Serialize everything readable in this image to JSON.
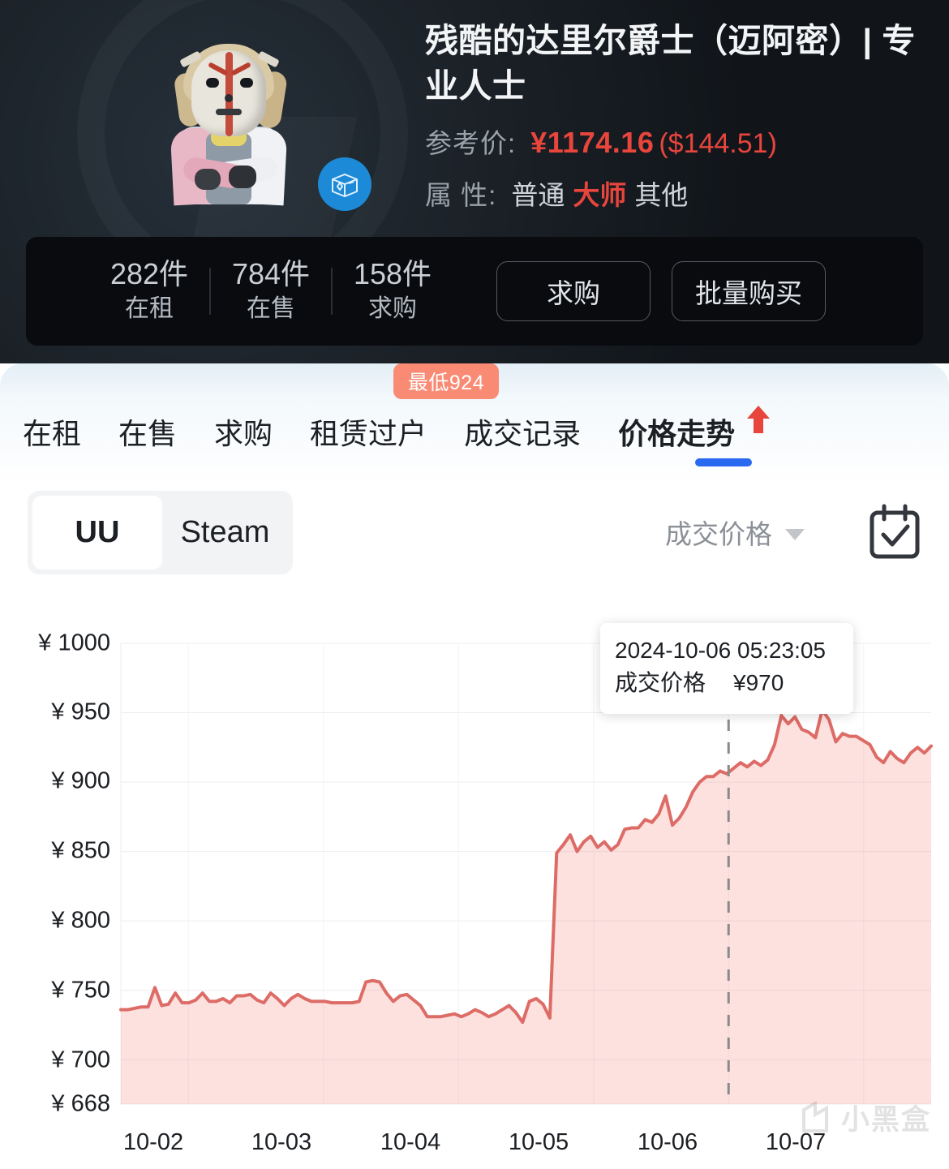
{
  "hero": {
    "title": "残酷的达里尔爵士（迈阿密）| 专业人士",
    "ref_price_label": "参考价:",
    "price_cny": "¥1174.16",
    "price_usd": "($144.51)",
    "attr_label": "属 性:",
    "attr_normal": "普通",
    "attr_highlight": "大师",
    "attr_other": "其他",
    "case_icon": "case-box-icon"
  },
  "stats": {
    "items": [
      {
        "count": "282件",
        "caption": "在租"
      },
      {
        "count": "784件",
        "caption": "在售"
      },
      {
        "count": "158件",
        "caption": "求购"
      }
    ],
    "buy_request_label": "求购",
    "bulk_buy_label": "批量购买"
  },
  "low_badge": "最低924",
  "tabs": [
    {
      "label": "在租",
      "active": false
    },
    {
      "label": "在售",
      "active": false
    },
    {
      "label": "求购",
      "active": false
    },
    {
      "label": "租赁过户",
      "active": false
    },
    {
      "label": "成交记录",
      "active": false
    },
    {
      "label": "价格走势",
      "active": true
    }
  ],
  "source_toggle": {
    "uu": "UU",
    "steam": "Steam",
    "selected": "UU"
  },
  "price_select": {
    "value": "成交价格"
  },
  "calendar_icon": "calendar-check-icon",
  "tooltip": {
    "date": "2024-10-06 05:23:05",
    "metric": "成交价格",
    "value": "¥970"
  },
  "watermark": "小黑盒",
  "colors": {
    "accent_red": "#e8453c",
    "line": "#dd6b66",
    "tab_indicator": "#2a6af0",
    "badge": "#f98b75"
  },
  "chart_data": {
    "type": "area",
    "title": "价格走势",
    "xlabel": "",
    "ylabel": "¥",
    "ylim": [
      668,
      1000
    ],
    "grid": true,
    "legend": false,
    "ytick_labels": [
      "¥ 1000",
      "¥ 950",
      "¥ 900",
      "¥ 850",
      "¥ 800",
      "¥ 750",
      "¥ 700",
      "¥ 668"
    ],
    "yticks": [
      1000,
      950,
      900,
      850,
      800,
      750,
      700,
      668
    ],
    "xtick_labels": [
      "10-02",
      "10-03",
      "10-04",
      "10-05",
      "10-06",
      "10-07"
    ],
    "xticks": [
      1,
      2,
      3,
      4,
      5,
      6
    ],
    "marker_line": {
      "x": "10-06",
      "value": 970,
      "style": "dashed"
    },
    "series": [
      {
        "name": "成交价格",
        "color": "#dd6b66",
        "fill": "rgba(240,120,110,0.22)",
        "x": [
          0,
          1,
          2,
          3,
          4,
          5,
          6,
          7,
          8,
          9,
          10,
          11,
          12,
          13,
          14,
          15,
          16,
          17,
          18,
          19,
          20,
          21,
          22,
          23,
          24,
          25,
          26,
          27,
          28,
          29,
          30,
          31,
          32,
          33,
          34,
          35,
          36,
          37,
          38,
          39,
          40,
          41,
          42,
          43,
          44,
          45,
          46,
          47,
          48,
          49,
          50,
          51,
          52,
          53,
          54,
          55,
          56,
          57,
          58,
          59,
          60,
          61,
          62,
          63,
          64,
          65,
          66,
          67,
          68,
          69,
          70,
          71,
          72,
          73,
          74,
          75,
          76,
          77,
          78,
          79,
          80,
          81,
          82,
          83,
          84,
          85,
          86,
          87,
          88,
          89,
          90,
          91,
          92,
          93,
          94,
          95,
          96,
          97,
          98,
          99,
          100,
          101,
          102,
          103,
          104,
          105,
          106,
          107,
          108,
          109,
          110,
          111,
          112,
          113,
          114,
          115,
          116,
          117,
          118,
          119
        ],
        "values": [
          736,
          736,
          737,
          738,
          738,
          752,
          739,
          740,
          748,
          741,
          741,
          743,
          748,
          742,
          742,
          744,
          741,
          746,
          746,
          747,
          743,
          741,
          748,
          744,
          739,
          744,
          747,
          744,
          742,
          742,
          742,
          741,
          741,
          741,
          741,
          742,
          756,
          757,
          756,
          748,
          742,
          746,
          747,
          743,
          739,
          731,
          731,
          731,
          732,
          733,
          731,
          733,
          736,
          734,
          731,
          733,
          736,
          739,
          734,
          727,
          742,
          744,
          740,
          730,
          849,
          855,
          862,
          850,
          857,
          861,
          853,
          857,
          851,
          855,
          866,
          867,
          867,
          873,
          871,
          877,
          890,
          869,
          874,
          882,
          893,
          900,
          904,
          904,
          908,
          906,
          910,
          914,
          911,
          915,
          912,
          916,
          927,
          948,
          942,
          947,
          938,
          936,
          932,
          952,
          945,
          929,
          935,
          933,
          933,
          930,
          927,
          918,
          914,
          922,
          917,
          914,
          921,
          925,
          921,
          926
        ]
      }
    ]
  }
}
